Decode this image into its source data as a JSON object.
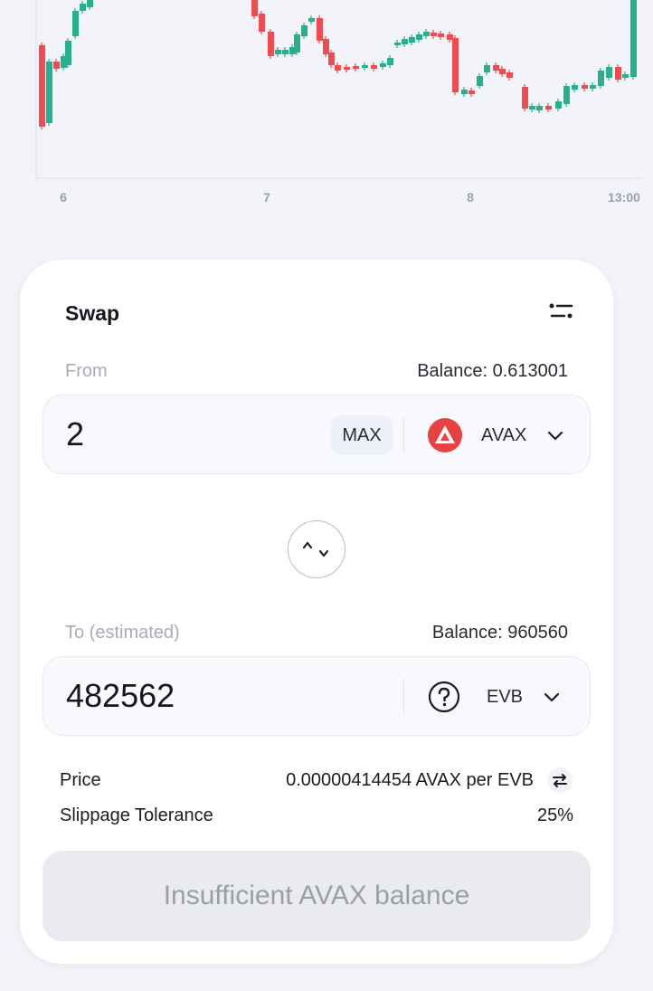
{
  "chart": {
    "x_ticks": [
      "6",
      "7",
      "8",
      "13:00"
    ],
    "colors": {
      "up": "#28b08e",
      "down": "#ef4b51",
      "axis": "#e2e5ec"
    }
  },
  "swap": {
    "title": "Swap",
    "settings_icon": "sliders-icon",
    "from": {
      "label": "From",
      "balance": "Balance: 0.613001",
      "amount": "2",
      "max_label": "MAX",
      "token": "AVAX",
      "token_icon": "avax-logo-icon",
      "token_color": "#e84142"
    },
    "switch_icon": "swap-direction-icon",
    "to": {
      "label": "To (estimated)",
      "balance": "Balance: 960560",
      "amount": "482562",
      "token": "EVB",
      "token_icon": "question-mark-icon"
    },
    "price": {
      "label": "Price",
      "value": "0.00000414454 AVAX per EVB"
    },
    "slippage": {
      "label": "Slippage Tolerance",
      "value": "25%"
    },
    "submit_label": "Insufficient AVAX balance"
  }
}
